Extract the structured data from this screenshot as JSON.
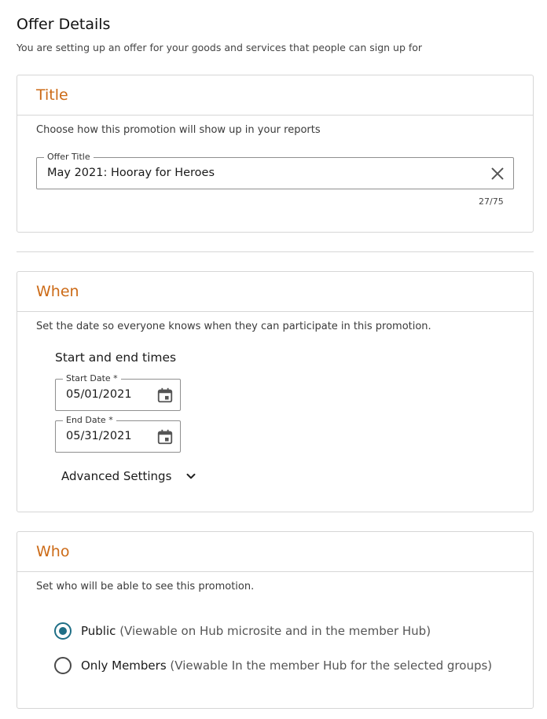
{
  "header": {
    "title": "Offer Details",
    "subtitle": "You are setting up an offer for your goods and services that people can sign up for"
  },
  "title_section": {
    "heading": "Title",
    "description": "Choose how this promotion will show up in your reports",
    "offer_title_label": "Offer Title",
    "offer_title_value": "May 2021: Hooray for Heroes",
    "char_counter": "27/75",
    "clear_icon": "close-icon"
  },
  "when_section": {
    "heading": "When",
    "description": "Set the date so everyone knows when they can participate in this promotion.",
    "times_heading": "Start and end times",
    "start_date_label": "Start Date *",
    "start_date_value": "05/01/2021",
    "end_date_label": "End Date *",
    "end_date_value": "05/31/2021",
    "calendar_icon": "calendar-icon",
    "advanced_settings_label": "Advanced Settings",
    "advanced_icon": "chevron-down-icon"
  },
  "who_section": {
    "heading": "Who",
    "description": "Set who will be able to see this promotion.",
    "options": [
      {
        "label": "Public",
        "note": "(Viewable on Hub microsite and in the member Hub)",
        "selected": true
      },
      {
        "label": "Only Members",
        "note": "(Viewable In the member Hub for the selected groups)",
        "selected": false
      }
    ]
  },
  "colors": {
    "accent": "#cc6a16",
    "radio_selected": "#1f6f86",
    "border": "#d6d6d6"
  }
}
